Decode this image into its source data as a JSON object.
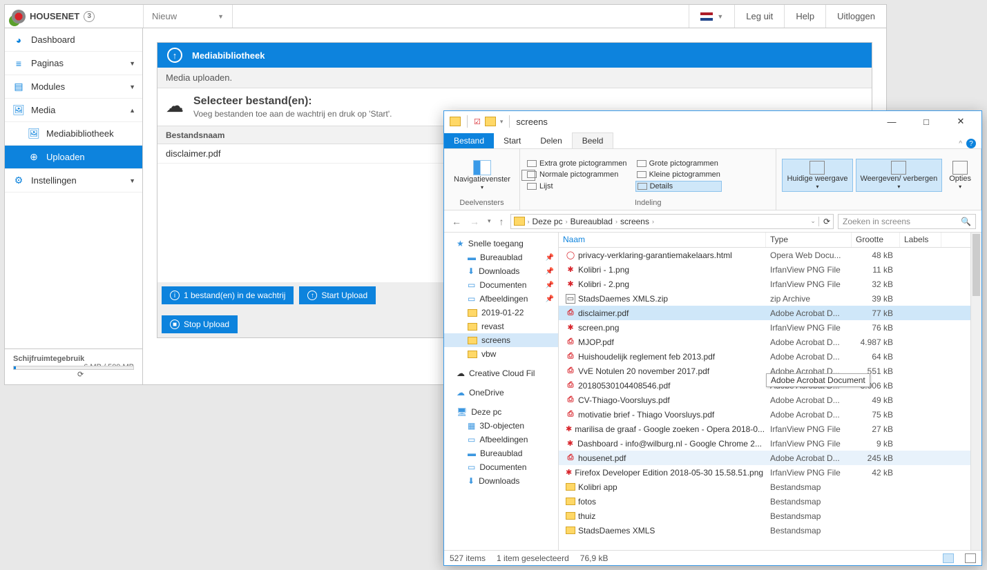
{
  "header": {
    "brand": "HOUSENET",
    "version": "3",
    "nieuw": "Nieuw",
    "flag_btn": "",
    "leg_uit": "Leg uit",
    "help": "Help",
    "uitloggen": "Uitloggen"
  },
  "sidebar": {
    "items": [
      {
        "label": "Dashboard",
        "icon": "◕"
      },
      {
        "label": "Paginas",
        "icon": "≡",
        "exp": "▼"
      },
      {
        "label": "Modules",
        "icon": "▤",
        "exp": "▼"
      },
      {
        "label": "Media",
        "icon": "🖼",
        "exp": "▲"
      },
      {
        "label": "Mediabibliotheek",
        "icon": "🖼",
        "sub": true
      },
      {
        "label": "Uploaden",
        "icon": "⊕",
        "sub": true,
        "sel": true
      },
      {
        "label": "Instellingen",
        "icon": "⚙",
        "exp": "▼"
      }
    ],
    "footer": {
      "title": "Schijfruimtegebruik",
      "usage": "6 MB / 500 MB"
    }
  },
  "panel": {
    "title": "Mediabibliotheek",
    "sub": "Media uploaden.",
    "select_title": "Selecteer bestand(en):",
    "select_desc": "Voeg bestanden toe aan de wachtrij en druk op 'Start'.",
    "col_name": "Bestandsnaam",
    "files": [
      "disclaimer.pdf"
    ],
    "btn_queue": "1 bestand(en) in de wachtrij",
    "btn_start": "Start Upload",
    "btn_stop": "Stop Upload"
  },
  "explorer": {
    "title": "screens",
    "tabs": {
      "bestand": "Bestand",
      "start": "Start",
      "delen": "Delen",
      "beeld": "Beeld"
    },
    "ribbon": {
      "nav": "Navigatievenster",
      "g1": "Deelvensters",
      "views": {
        "extra": "Extra grote pictogrammen",
        "grote": "Grote pictogrammen",
        "normale": "Normale pictogrammen",
        "kleine": "Kleine pictogrammen",
        "lijst": "Lijst",
        "details": "Details"
      },
      "g2": "Indeling",
      "huidige": "Huidige weergave",
      "weergeven": "Weergeven/ verbergen",
      "opties": "Opties"
    },
    "breadcrumb": [
      "Deze pc",
      "Bureaublad",
      "screens"
    ],
    "search_placeholder": "Zoeken in screens",
    "tree": [
      {
        "l": "Snelle toegang",
        "i": "★",
        "c": "ti-star"
      },
      {
        "l": "Bureaublad",
        "i": "▬",
        "c": "ti-desk",
        "l2": true,
        "pin": true
      },
      {
        "l": "Downloads",
        "i": "⬇",
        "c": "ti-desk",
        "l2": true,
        "pin": true
      },
      {
        "l": "Documenten",
        "i": "▭",
        "c": "ti-desk",
        "l2": true,
        "pin": true
      },
      {
        "l": "Afbeeldingen",
        "i": "▭",
        "c": "ti-desk",
        "l2": true,
        "pin": true
      },
      {
        "l": "2019-01-22",
        "i": "",
        "c": "ti-fold",
        "l2": true
      },
      {
        "l": "revast",
        "i": "",
        "c": "ti-fold",
        "l2": true
      },
      {
        "l": "screens",
        "i": "",
        "c": "ti-fold",
        "l2": true,
        "sel": true
      },
      {
        "l": "vbw",
        "i": "",
        "c": "ti-fold",
        "l2": true
      },
      {
        "l": "Creative Cloud Fil",
        "i": "☁",
        "c": "",
        "l2": false,
        "gap": true
      },
      {
        "l": "OneDrive",
        "i": "☁",
        "c": "ti-desk",
        "gap": true
      },
      {
        "l": "Deze pc",
        "i": "🖥",
        "c": "ti-desk",
        "gap": true
      },
      {
        "l": "3D-objecten",
        "i": "▦",
        "c": "ti-desk",
        "l2": true
      },
      {
        "l": "Afbeeldingen",
        "i": "▭",
        "c": "ti-desk",
        "l2": true
      },
      {
        "l": "Bureaublad",
        "i": "▬",
        "c": "ti-desk",
        "l2": true
      },
      {
        "l": "Documenten",
        "i": "▭",
        "c": "ti-desk",
        "l2": true
      },
      {
        "l": "Downloads",
        "i": "⬇",
        "c": "ti-desk",
        "l2": true
      }
    ],
    "cols": {
      "name": "Naam",
      "type": "Type",
      "size": "Grootte",
      "labels": "Labels"
    },
    "rows": [
      {
        "n": "privacy-verklaring-garantiemakelaars.html",
        "t": "Opera Web Docu...",
        "s": "48 kB",
        "k": "html"
      },
      {
        "n": "Kolibri - 1.png",
        "t": "IrfanView PNG File",
        "s": "11 kB",
        "k": "png"
      },
      {
        "n": "Kolibri - 2.png",
        "t": "IrfanView PNG File",
        "s": "32 kB",
        "k": "png"
      },
      {
        "n": "StadsDaemes XMLS.zip",
        "t": "zip Archive",
        "s": "39 kB",
        "k": "zip"
      },
      {
        "n": "disclaimer.pdf",
        "t": "Adobe Acrobat D...",
        "s": "77 kB",
        "k": "pdf",
        "sel": true
      },
      {
        "n": "screen.png",
        "t": "IrfanView PNG File",
        "s": "76 kB",
        "k": "png"
      },
      {
        "n": "MJOP.pdf",
        "t": "Adobe Acrobat D...",
        "s": "4.987 kB",
        "k": "pdf"
      },
      {
        "n": "Huishoudelijk reglement feb 2013.pdf",
        "t": "Adobe Acrobat D...",
        "s": "64 kB",
        "k": "pdf"
      },
      {
        "n": "VvE Notulen 20 november 2017.pdf",
        "t": "Adobe Acrobat D...",
        "s": "551 kB",
        "k": "pdf"
      },
      {
        "n": "20180530104408546.pdf",
        "t": "Adobe Acrobat D...",
        "s": "3.006 kB",
        "k": "pdf"
      },
      {
        "n": "CV-Thiago-Voorsluys.pdf",
        "t": "Adobe Acrobat D...",
        "s": "49 kB",
        "k": "pdf"
      },
      {
        "n": "motivatie brief - Thiago Voorsluys.pdf",
        "t": "Adobe Acrobat D...",
        "s": "75 kB",
        "k": "pdf"
      },
      {
        "n": "marilisa de graaf - Google zoeken - Opera 2018-0...",
        "t": "IrfanView PNG File",
        "s": "27 kB",
        "k": "png"
      },
      {
        "n": "Dashboard - info@wilburg.nl - Google Chrome 2...",
        "t": "IrfanView PNG File",
        "s": "9 kB",
        "k": "png"
      },
      {
        "n": "housenet.pdf",
        "t": "Adobe Acrobat D...",
        "s": "245 kB",
        "k": "pdf",
        "hov": true
      },
      {
        "n": "Firefox Developer Edition 2018-05-30 15.58.51.png",
        "t": "IrfanView PNG File",
        "s": "42 kB",
        "k": "png"
      },
      {
        "n": "Kolibri app",
        "t": "Bestandsmap",
        "s": "",
        "k": "fold"
      },
      {
        "n": "fotos",
        "t": "Bestandsmap",
        "s": "",
        "k": "fold"
      },
      {
        "n": "thuiz",
        "t": "Bestandsmap",
        "s": "",
        "k": "fold"
      },
      {
        "n": "StadsDaemes XMLS",
        "t": "Bestandsmap",
        "s": "",
        "k": "fold"
      }
    ],
    "tooltip": "Adobe Acrobat Document",
    "status": {
      "items": "527 items",
      "sel": "1 item geselecteerd",
      "size": "76,9 kB"
    }
  }
}
